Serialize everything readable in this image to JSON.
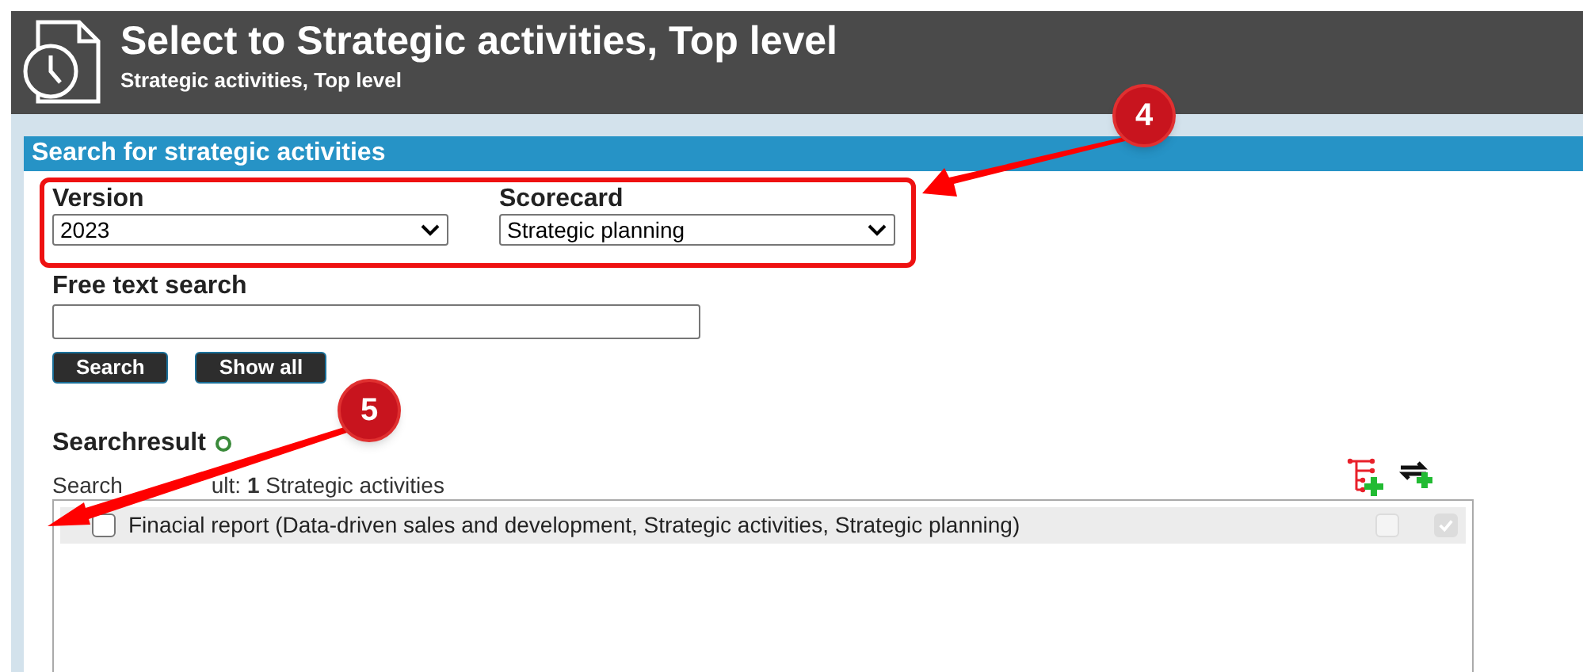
{
  "header": {
    "title": "Select to Strategic activities, Top level",
    "subtitle": "Strategic activities, Top level"
  },
  "panel": {
    "title": "Search for strategic activities"
  },
  "filters": [
    {
      "label": "Version",
      "value": "2023"
    },
    {
      "label": "Scorecard",
      "value": "Strategic planning"
    }
  ],
  "free_text": {
    "label": "Free text search"
  },
  "buttons": [
    "Search",
    "Show all"
  ],
  "results": {
    "title": "Searchresult",
    "summary": [
      "Search",
      "ult: **1** Strategic activities"
    ],
    "rows": [
      {
        "label": "Finacial report (Data-driven sales and development, Strategic activities, Strategic planning)",
        "checked": false,
        "column_2_checked": false,
        "column_3_checked": true
      }
    ]
  },
  "callouts": [
    {
      "number": "4"
    },
    {
      "number": "5"
    }
  ]
}
